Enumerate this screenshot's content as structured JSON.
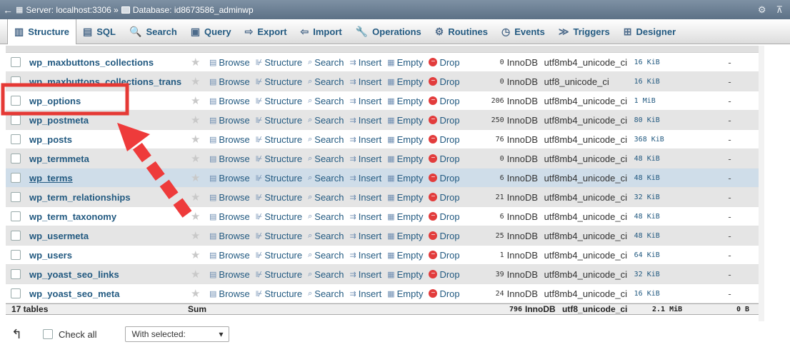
{
  "titlebar": {
    "back_label": "←",
    "breadcrumb_server": "Server: localhost:3306 »",
    "breadcrumb_db": "Database: id8673586_adminwp",
    "gear": "⚙",
    "collapse": "⊼"
  },
  "tabs": [
    {
      "label": "Structure",
      "icon": "▥"
    },
    {
      "label": "SQL",
      "icon": "▤"
    },
    {
      "label": "Search",
      "icon": "🔍"
    },
    {
      "label": "Query",
      "icon": "▣"
    },
    {
      "label": "Export",
      "icon": "⇨"
    },
    {
      "label": "Import",
      "icon": "⇦"
    },
    {
      "label": "Operations",
      "icon": "🔧"
    },
    {
      "label": "Routines",
      "icon": "⚙"
    },
    {
      "label": "Events",
      "icon": "◷"
    },
    {
      "label": "Triggers",
      "icon": "≫"
    },
    {
      "label": "Designer",
      "icon": "⊞"
    }
  ],
  "actions": {
    "browse": "Browse",
    "structure": "Structure",
    "search": "Search",
    "insert": "Insert",
    "empty": "Empty",
    "drop": "Drop"
  },
  "rows": [
    {
      "name": "wp_maxbuttons_collections",
      "rows": "0",
      "engine": "InnoDB",
      "collation": "utf8mb4_unicode_ci",
      "size": "16 KiB",
      "overhead": "-"
    },
    {
      "name": "wp_maxbuttons_collections_trans",
      "rows": "0",
      "engine": "InnoDB",
      "collation": "utf8_unicode_ci",
      "size": "16 KiB",
      "overhead": "-"
    },
    {
      "name": "wp_options",
      "rows": "206",
      "engine": "InnoDB",
      "collation": "utf8mb4_unicode_ci",
      "size": "1 MiB",
      "overhead": "-"
    },
    {
      "name": "wp_postmeta",
      "rows": "250",
      "engine": "InnoDB",
      "collation": "utf8mb4_unicode_ci",
      "size": "80 KiB",
      "overhead": "-"
    },
    {
      "name": "wp_posts",
      "rows": "76",
      "engine": "InnoDB",
      "collation": "utf8mb4_unicode_ci",
      "size": "368 KiB",
      "overhead": "-"
    },
    {
      "name": "wp_termmeta",
      "rows": "0",
      "engine": "InnoDB",
      "collation": "utf8mb4_unicode_ci",
      "size": "48 KiB",
      "overhead": "-"
    },
    {
      "name": "wp_terms",
      "rows": "6",
      "engine": "InnoDB",
      "collation": "utf8mb4_unicode_ci",
      "size": "48 KiB",
      "overhead": "-"
    },
    {
      "name": "wp_term_relationships",
      "rows": "21",
      "engine": "InnoDB",
      "collation": "utf8mb4_unicode_ci",
      "size": "32 KiB",
      "overhead": "-"
    },
    {
      "name": "wp_term_taxonomy",
      "rows": "6",
      "engine": "InnoDB",
      "collation": "utf8mb4_unicode_ci",
      "size": "48 KiB",
      "overhead": "-"
    },
    {
      "name": "wp_usermeta",
      "rows": "25",
      "engine": "InnoDB",
      "collation": "utf8mb4_unicode_ci",
      "size": "48 KiB",
      "overhead": "-"
    },
    {
      "name": "wp_users",
      "rows": "1",
      "engine": "InnoDB",
      "collation": "utf8mb4_unicode_ci",
      "size": "64 KiB",
      "overhead": "-"
    },
    {
      "name": "wp_yoast_seo_links",
      "rows": "39",
      "engine": "InnoDB",
      "collation": "utf8mb4_unicode_ci",
      "size": "32 KiB",
      "overhead": "-"
    },
    {
      "name": "wp_yoast_seo_meta",
      "rows": "24",
      "engine": "InnoDB",
      "collation": "utf8mb4_unicode_ci",
      "size": "16 KiB",
      "overhead": "-"
    }
  ],
  "summary": {
    "tables": "17 tables",
    "sum": "Sum",
    "rows": "796",
    "engine": "InnoDB",
    "collation": "utf8_unicode_ci",
    "size": "2.1 MiB",
    "overhead": "0 B"
  },
  "footer": {
    "check_all": "Check all",
    "with_selected": "With selected:",
    "arrow": "↰"
  },
  "colors": {
    "highlight_box": "#e53935",
    "arrow": "#ee3b3b"
  }
}
